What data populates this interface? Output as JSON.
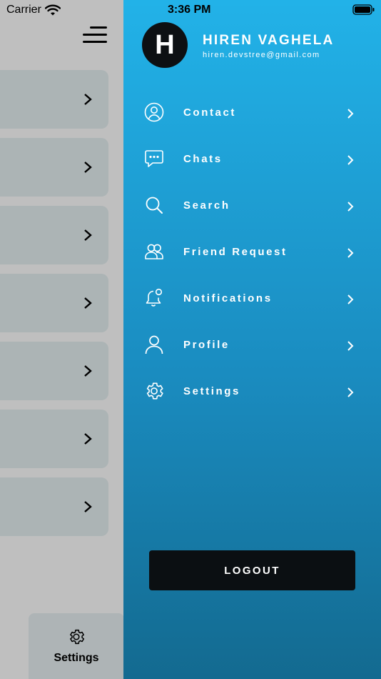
{
  "status_bar": {
    "carrier": "Carrier",
    "time": "3:36 PM"
  },
  "background": {
    "menu_icon": "hamburger-icon",
    "cards": [
      {
        "chevron": "chevron-right-icon"
      },
      {
        "chevron": "chevron-right-icon"
      },
      {
        "chevron": "chevron-right-icon"
      },
      {
        "chevron": "chevron-right-icon"
      },
      {
        "chevron": "chevron-right-icon"
      },
      {
        "chevron": "chevron-right-icon"
      },
      {
        "chevron": "chevron-right-icon"
      }
    ],
    "tab_bar": {
      "active_tab": {
        "label": "Settings",
        "icon": "gear-icon"
      }
    }
  },
  "drawer": {
    "avatar_initial": "H",
    "user_name": "HIREN VAGHELA",
    "user_email": "hiren.devstree@gmail.com",
    "menu_items": [
      {
        "label": "Contact",
        "icon": "contact-icon"
      },
      {
        "label": "Chats",
        "icon": "chat-icon"
      },
      {
        "label": "Search",
        "icon": "search-icon"
      },
      {
        "label": "Friend Request",
        "icon": "friends-icon"
      },
      {
        "label": "Notifications",
        "icon": "bell-icon"
      },
      {
        "label": "Profile",
        "icon": "user-icon"
      },
      {
        "label": "Settings",
        "icon": "gear-icon"
      }
    ],
    "logout_label": "LOGOUT"
  },
  "colors": {
    "drawer_top": "#22b2e8",
    "drawer_bottom": "#136a90",
    "logout_bg": "#0b0f12",
    "card_bg": "#e6f0f2"
  }
}
